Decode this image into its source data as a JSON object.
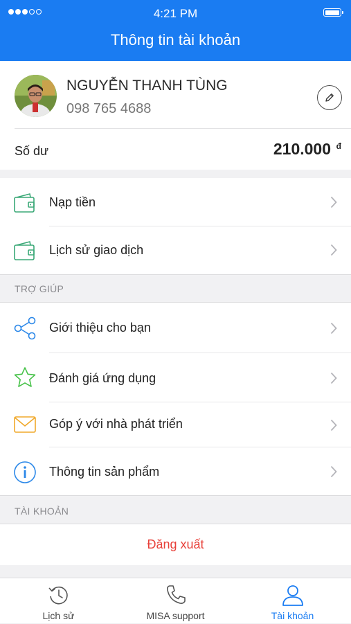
{
  "status_bar": {
    "time": "4:21 PM",
    "signal_dots_filled": 3,
    "signal_dots_total": 5,
    "battery_level": 1.0
  },
  "header": {
    "title": "Thông tin tài khoản"
  },
  "profile": {
    "name": "NGUYỄN THANH TÙNG",
    "phone": "098 765 4688",
    "balance_label": "Số dư",
    "balance_value": "210.000",
    "currency": "đ"
  },
  "wallet_menu": [
    {
      "label": "Nạp tiền",
      "icon": "wallet-icon"
    },
    {
      "label": "Lịch sử giao dịch",
      "icon": "wallet-icon"
    }
  ],
  "help_section": {
    "title": "TRỢ GIÚP",
    "items": [
      {
        "label": "Giới thiệu cho bạn",
        "icon": "share-icon"
      },
      {
        "label": "Đánh giá ứng dụng",
        "icon": "star-icon"
      },
      {
        "label": "Góp ý với nhà phát triển",
        "icon": "mail-icon"
      },
      {
        "label": "Thông tin sản phẩm",
        "icon": "info-icon"
      }
    ]
  },
  "account_section": {
    "title": "TÀI KHOẢN",
    "logout_label": "Đăng xuất"
  },
  "tabbar": {
    "tabs": [
      {
        "label": "Lịch sử",
        "icon": "history-icon",
        "active": false
      },
      {
        "label": "MISA support",
        "icon": "phone-icon",
        "active": false
      },
      {
        "label": "Tài khoản",
        "icon": "user-icon",
        "active": true
      }
    ]
  },
  "colors": {
    "primary": "#1a7cf2",
    "logout": "#e8413a",
    "wallet_icon": "#3aa877",
    "star_icon": "#48c24a",
    "mail_icon": "#f0a82a",
    "share_icon": "#2a87e8"
  }
}
